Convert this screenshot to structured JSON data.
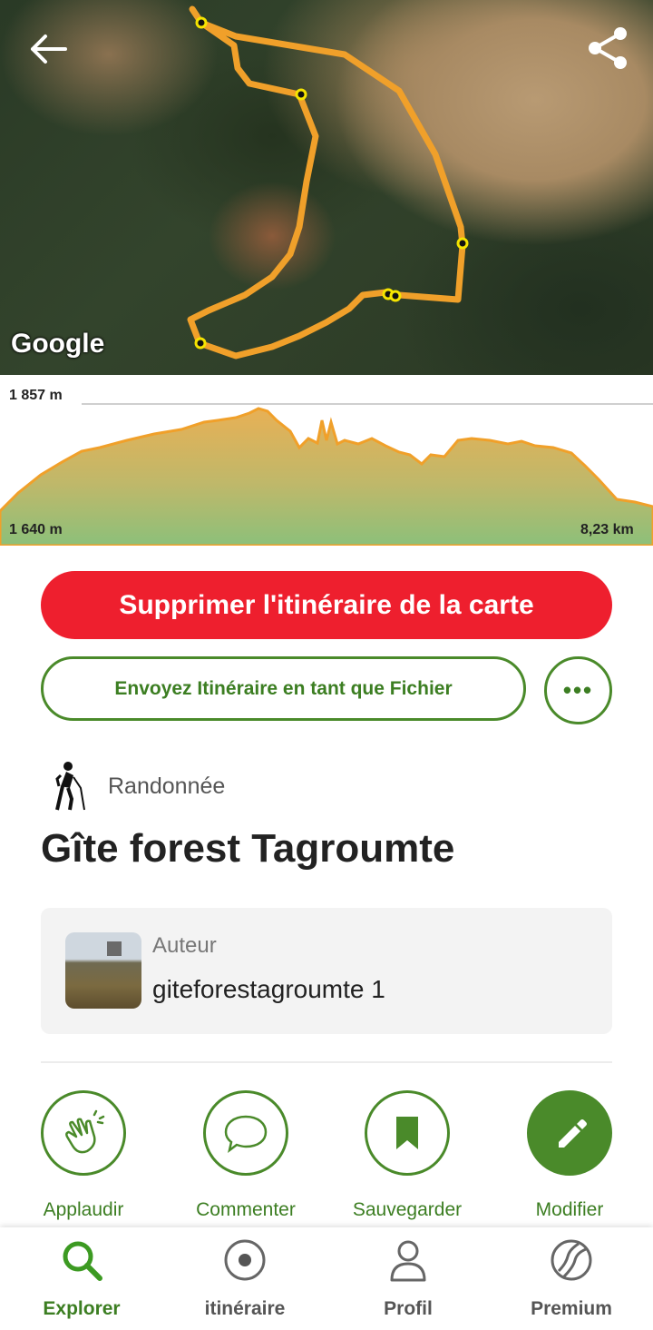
{
  "map": {
    "google_label": "Google"
  },
  "elevation": {
    "max_label": "1 857 m",
    "min_label": "1 640 m",
    "distance_label": "8,23 km"
  },
  "buttons": {
    "remove_route": "Supprimer l'itinéraire de la carte",
    "send_file": "Envoyez Itinéraire en tant que Fichier",
    "more": "•••"
  },
  "route": {
    "activity": "Randonnée",
    "title": "Gîte forest Tagroumte"
  },
  "author": {
    "label": "Auteur",
    "name": "giteforestagroumte 1"
  },
  "actions": [
    {
      "label": "Applaudir"
    },
    {
      "label": "Commenter"
    },
    {
      "label": "Sauvegarder"
    },
    {
      "label": "Modifier"
    }
  ],
  "nav": [
    {
      "label": "Explorer",
      "active": true
    },
    {
      "label": "itinéraire",
      "active": false
    },
    {
      "label": "Profil",
      "active": false
    },
    {
      "label": "Premium",
      "active": false
    }
  ],
  "colors": {
    "accent_green": "#4a8a2a",
    "danger_red": "#ee1f2e",
    "route_orange": "#f0a02a"
  }
}
